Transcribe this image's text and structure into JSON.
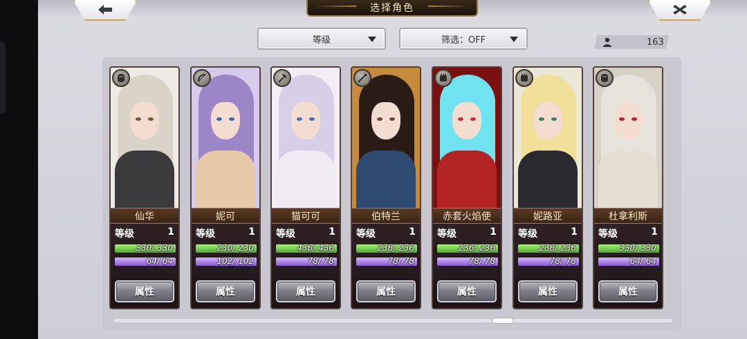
{
  "header": {
    "title": "选择角色",
    "back_icon": "back-arrow-icon",
    "close_icon": "close-x-icon"
  },
  "filters": {
    "sort_label": "等级",
    "filter_label": "筛选：OFF"
  },
  "roster_count": "163",
  "colors": {
    "hp_fill": "#5fc23a",
    "mp_fill": "#9b6ee6",
    "name_plate": "#4a2e1c",
    "frame_gold": "#c8a655"
  },
  "cards": [
    {
      "name": "仙华",
      "level_label": "等级",
      "level": "1",
      "hp_text": "330/ 330",
      "mp_text": "64/ 64",
      "hp_fraction": 1.0,
      "mp_fraction": 1.0,
      "attr_label": "属性",
      "class_icon": "fist-icon"
    },
    {
      "name": "妮可",
      "level_label": "等级",
      "level": "1",
      "hp_text": "230/ 230",
      "mp_text": "102/ 102",
      "hp_fraction": 1.0,
      "mp_fraction": 1.0,
      "attr_label": "属性",
      "class_icon": "bow-icon"
    },
    {
      "name": "猫可可",
      "level_label": "等级",
      "level": "1",
      "hp_text": "436/ 436",
      "mp_text": "78/ 78",
      "hp_fraction": 1.0,
      "mp_fraction": 1.0,
      "attr_label": "属性",
      "class_icon": "axe-icon"
    },
    {
      "name": "伯特兰",
      "level_label": "等级",
      "level": "1",
      "hp_text": "236/ 236",
      "mp_text": "78/ 78",
      "hp_fraction": 1.0,
      "mp_fraction": 1.0,
      "attr_label": "属性",
      "class_icon": "spear-icon"
    },
    {
      "name": "赤套火焰使",
      "level_label": "等级",
      "level": "1",
      "hp_text": "236/ 236",
      "mp_text": "78/ 78",
      "hp_fraction": 1.0,
      "mp_fraction": 1.0,
      "attr_label": "属性",
      "class_icon": "gauntlet-icon"
    },
    {
      "name": "妮路亚",
      "level_label": "等级",
      "level": "1",
      "hp_text": "236/ 236",
      "mp_text": "78/ 78",
      "hp_fraction": 1.0,
      "mp_fraction": 1.0,
      "attr_label": "属性",
      "class_icon": "gauntlet-icon"
    },
    {
      "name": "杜拿利斯",
      "level_label": "等级",
      "level": "1",
      "hp_text": "330/ 330",
      "mp_text": "64/ 64",
      "hp_fraction": 1.0,
      "mp_fraction": 1.0,
      "attr_label": "属性",
      "class_icon": "fist-icon"
    }
  ]
}
